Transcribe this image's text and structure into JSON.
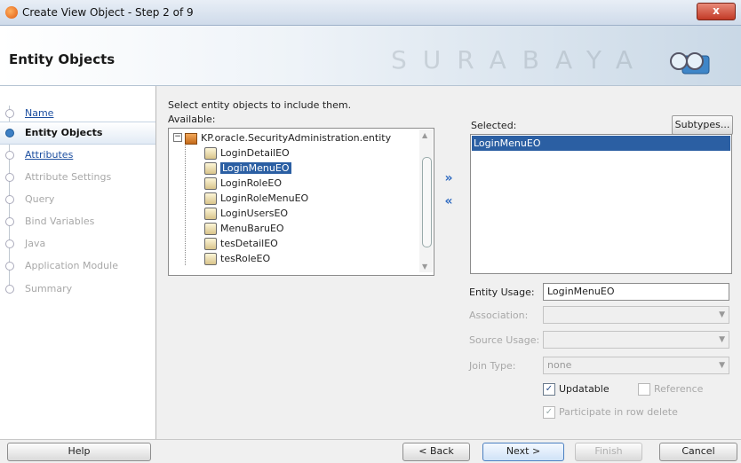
{
  "window": {
    "title": "Create View Object - Step 2 of 9",
    "close_label": "x"
  },
  "header": {
    "title": "Entity Objects",
    "watermark": "SURABAYA"
  },
  "steps": [
    {
      "label": "Name",
      "state": "link"
    },
    {
      "label": "Entity Objects",
      "state": "current"
    },
    {
      "label": "Attributes",
      "state": "link"
    },
    {
      "label": "Attribute Settings",
      "state": "dim"
    },
    {
      "label": "Query",
      "state": "dim"
    },
    {
      "label": "Bind Variables",
      "state": "dim"
    },
    {
      "label": "Java",
      "state": "dim"
    },
    {
      "label": "Application Module",
      "state": "dim"
    },
    {
      "label": "Summary",
      "state": "dim"
    }
  ],
  "main": {
    "instruction": "Select entity objects to include them.",
    "available_label": "Available:",
    "tree": {
      "root": "KP.oracle.SecurityAdministration.entity",
      "items": [
        "LoginDetailEO",
        "LoginMenuEO",
        "LoginRoleEO",
        "LoginRoleMenuEO",
        "LoginUsersEO",
        "MenuBaruEO",
        "tesDetailEO",
        "tesRoleEO"
      ],
      "selected": "LoginMenuEO"
    },
    "move_right": "»",
    "move_left": "«",
    "selected_label": "Selected:",
    "subtypes_label": "Subtypes...",
    "selected_items": [
      "LoginMenuEO"
    ]
  },
  "form": {
    "entity_usage_label": "Entity Usage:",
    "entity_usage_value": "LoginMenuEO",
    "association_label": "Association:",
    "source_usage_label": "Source Usage:",
    "join_type_label": "Join Type:",
    "join_type_value": "none",
    "updatable_label": "Updatable",
    "reference_label": "Reference",
    "participate_label": "Participate in row delete"
  },
  "footer": {
    "help": "Help",
    "back": "< Back",
    "next": "Next >",
    "finish": "Finish",
    "cancel": "Cancel"
  }
}
